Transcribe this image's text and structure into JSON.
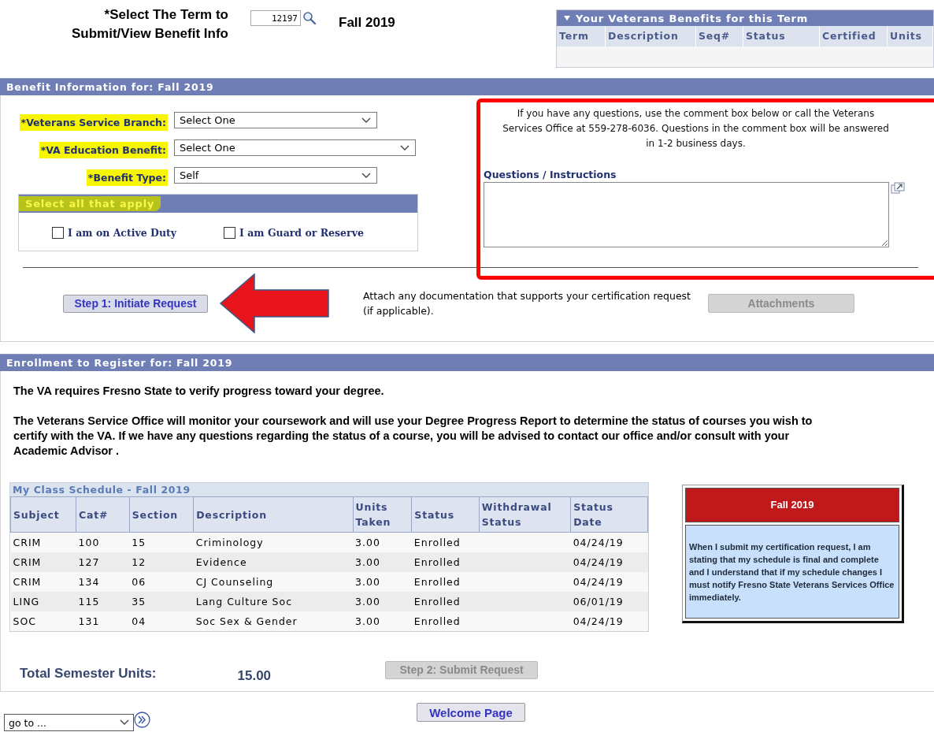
{
  "term_selector": {
    "label_lines": [
      "*Select The Term to",
      "Submit/View Benefit Info"
    ],
    "value": "12197",
    "term_name": "Fall 2019"
  },
  "benefits_grid": {
    "title": "Your Veterans Benefits for this Term",
    "expanded": true,
    "columns": [
      "Term",
      "Description",
      "Seq#",
      "Status",
      "Certified",
      "Units"
    ]
  },
  "benefit_section": {
    "title": "Benefit Information for: Fall 2019",
    "fields": [
      {
        "label": "*Veterans Service Branch:",
        "value": "Select One",
        "highlighted": true
      },
      {
        "label": "*VA Education Benefit:",
        "value": "Select One",
        "highlighted": true
      },
      {
        "label": "*Benefit Type:",
        "value": "Self",
        "highlighted": true
      }
    ],
    "options_group": {
      "title": "Select all that apply",
      "highlighted": true,
      "options": [
        {
          "label": "I am on Active Duty",
          "checked": false
        },
        {
          "label": "I am Guard or Reserve",
          "checked": false
        }
      ]
    },
    "notice": "If you have any questions, use the comment box below or call the Veterans Services Office at 559-278-6036. Questions in the comment box will be answered in 1-2 business days.",
    "comment": {
      "label": "Questions / Instructions"
    },
    "step1_button": "Step 1: Initiate Request",
    "attach_text": "Attach any documentation that supports your certification request (if applicable).",
    "attachments_button": {
      "label": "Attachments",
      "disabled": true
    }
  },
  "enrollment_section": {
    "title": "Enrollment to Register for: Fall 2019",
    "paragraphs": [
      "The VA requires Fresno State to verify progress toward your degree.",
      "The Veterans Service Office will monitor your coursework and will use your Degree Progress Report to determine the status of courses you wish to certify with the VA. If we have any questions regarding the status of a course, you will be advised to contact our office and/or consult with your Academic Advisor ."
    ],
    "schedule": {
      "title": "My Class Schedule - Fall 2019",
      "columns": [
        "Subject",
        "Cat#",
        "Section",
        "Description",
        "Units Taken",
        "Status",
        "Withdrawal Status",
        "Status Date"
      ],
      "rows": [
        [
          "CRIM",
          "100",
          "15",
          "Criminology",
          "3.00",
          "Enrolled",
          "",
          "04/24/19"
        ],
        [
          "CRIM",
          "127",
          "12",
          "Evidence",
          "3.00",
          "Enrolled",
          "",
          "04/24/19"
        ],
        [
          "CRIM",
          "134",
          "06",
          "CJ Counseling",
          "3.00",
          "Enrolled",
          "",
          "04/24/19"
        ],
        [
          "LING",
          "115",
          "35",
          "Lang Culture Soc",
          "3.00",
          "Enrolled",
          "",
          "06/01/19"
        ],
        [
          "SOC",
          "131",
          "04",
          "Soc Sex & Gender",
          "3.00",
          "Enrolled",
          "",
          "04/24/19"
        ]
      ]
    },
    "notice_box": {
      "title": "Fall 2019",
      "text": "When I submit my certification request, I am stating that my schedule is final and complete and I understand that if my schedule changes I must notify Fresno State Veterans Services Office immediately."
    },
    "total_label": "Total Semester Units:",
    "total_value": "15.00",
    "submit_button": {
      "label": "Step 2: Submit Request",
      "disabled": true
    }
  },
  "footer": {
    "goto": "go to ...",
    "welcome_button": "Welcome Page"
  }
}
